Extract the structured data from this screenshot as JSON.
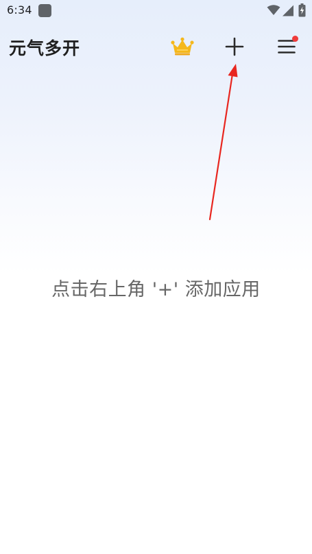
{
  "status_bar": {
    "time": "6:34",
    "icons": [
      "app-notification-icon",
      "wifi-icon",
      "cell-signal-icon",
      "battery-charging-icon"
    ]
  },
  "app_bar": {
    "title": "元气多开",
    "actions": [
      "crown-icon",
      "plus-icon",
      "menu-icon"
    ],
    "menu_has_notification_dot": true
  },
  "main": {
    "empty_hint": "点击右上角 '+' 添加应用"
  },
  "colors": {
    "title": "#1f1f1f",
    "hint_text": "#666666",
    "crown": "#f5b81c",
    "badge_dot": "#ef3b3b",
    "arrow": "#e8261f",
    "background_top": "#e6eefb",
    "background_bottom": "#ffffff"
  }
}
